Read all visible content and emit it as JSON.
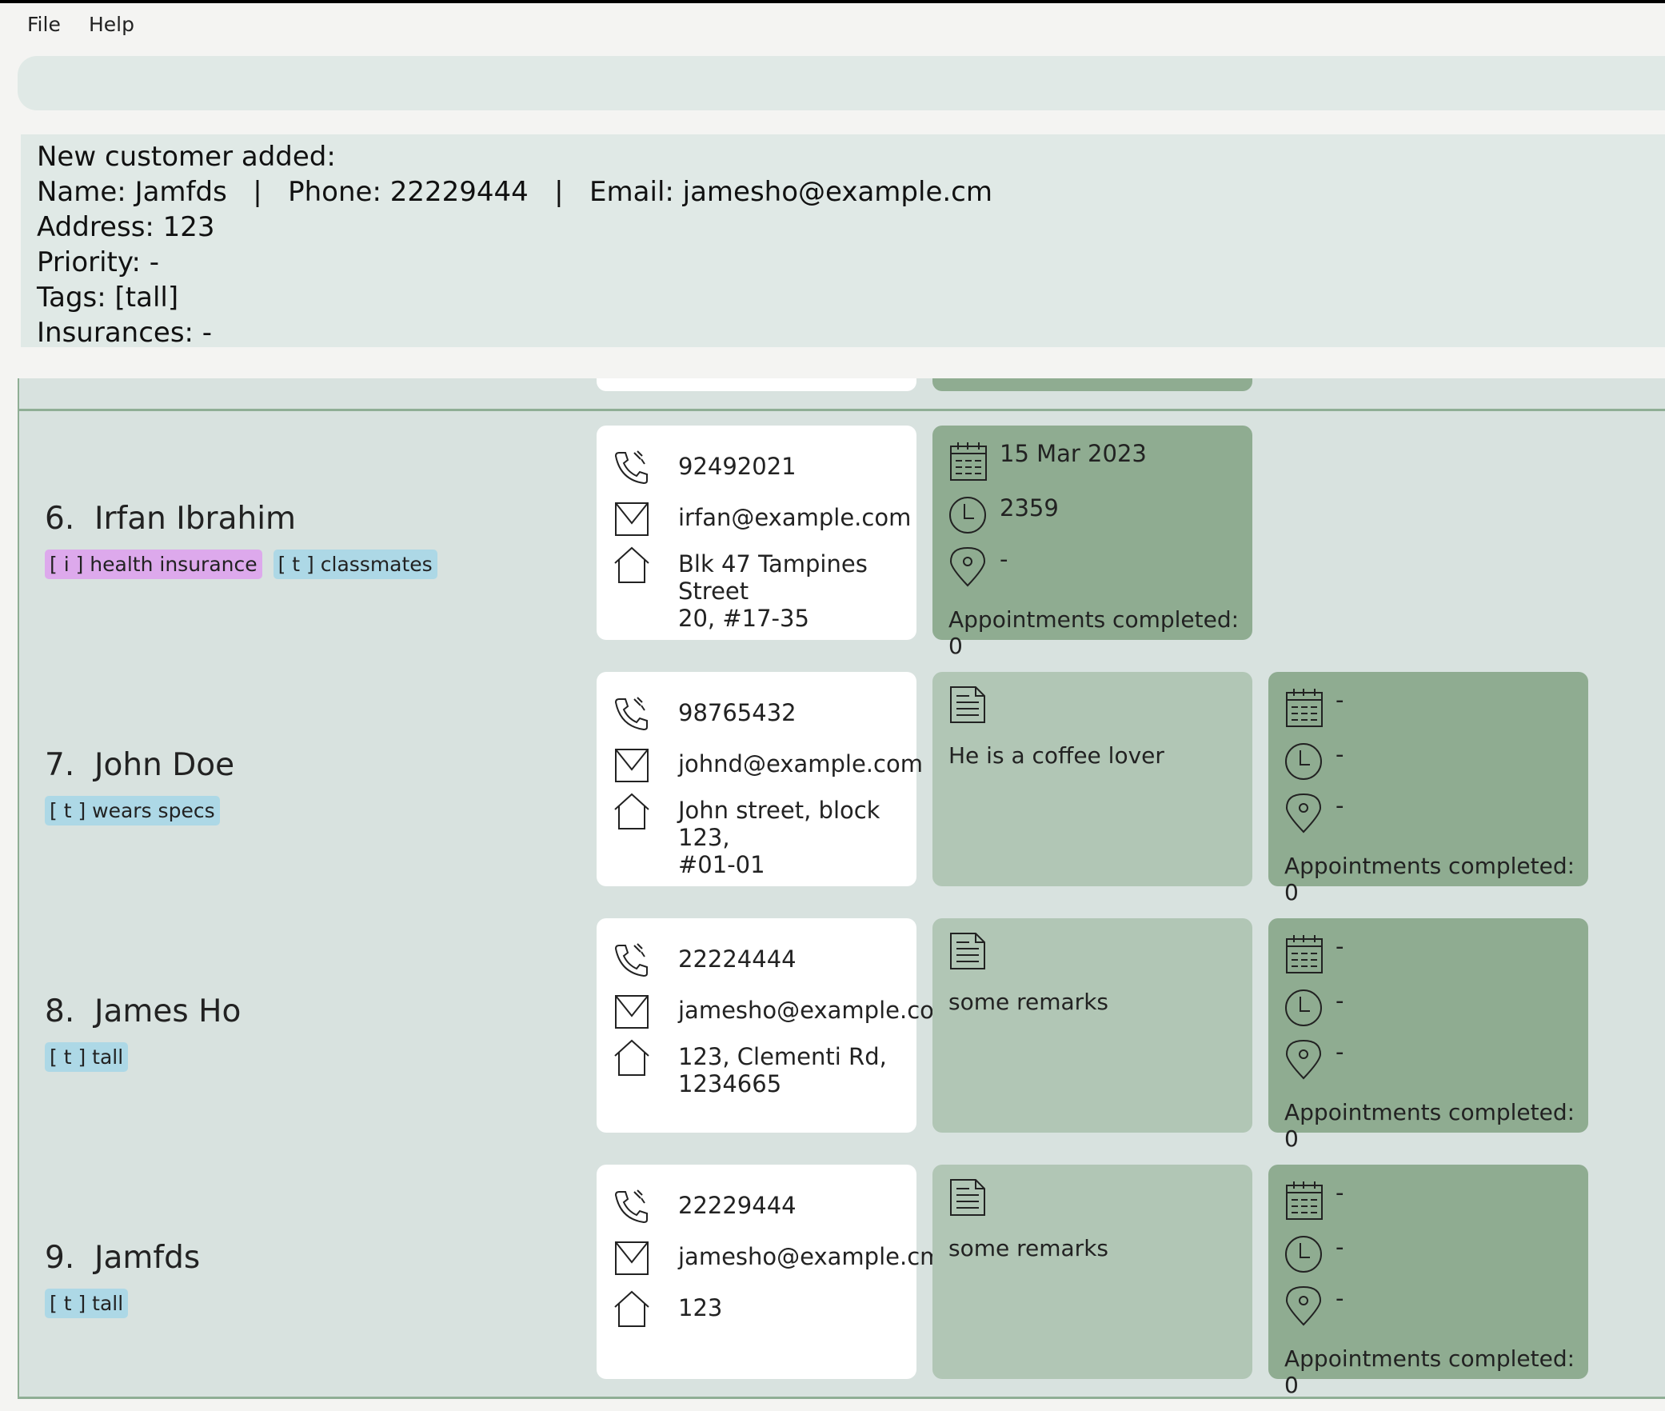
{
  "menu": {
    "file": "File",
    "help": "Help"
  },
  "command_box": {
    "value": ""
  },
  "result": {
    "line1": "New customer added:",
    "line2": "Name: Jamfds   |   Phone: 22229444   |   Email: jamesho@example.cm",
    "line3": "Address: 123",
    "line4": "Priority: -",
    "line5": "Tags: [tall]",
    "line6": "Insurances: -"
  },
  "customers": [
    {
      "index": "6.",
      "name": "Irfan Ibrahim",
      "insurance_tag": "[ i ] health insurance",
      "tag": "[ t ] classmates",
      "phone": "92492021",
      "email": "irfan@example.com",
      "address_line1": "Blk 47 Tampines Street",
      "address_line2": "20, #17-35",
      "appt_date": "15 Mar 2023",
      "appt_time": "2359",
      "appt_location": "-",
      "appt_completed": "Appointments completed: 0"
    },
    {
      "index": "7.",
      "name": "John Doe",
      "tag": "[ t ] wears specs",
      "phone": "98765432",
      "email": "johnd@example.com",
      "address_line1": "John street, block 123,",
      "address_line2": "#01-01",
      "remark": "He is a coffee lover",
      "appt_date": "-",
      "appt_time": "-",
      "appt_location": "-",
      "appt_completed": "Appointments completed: 0"
    },
    {
      "index": "8.",
      "name": "James Ho",
      "tag": "[ t ] tall",
      "phone": "22224444",
      "email": "jamesho@example.com",
      "address_line1": "123, Clementi Rd,",
      "address_line2": "1234665",
      "remark": "some remarks",
      "appt_date": "-",
      "appt_time": "-",
      "appt_location": "-",
      "appt_completed": "Appointments completed: 0"
    },
    {
      "index": "9.",
      "name": "Jamfds",
      "tag": "[ t ] tall",
      "phone": "22229444",
      "email": "jamesho@example.cm",
      "address_line1": "123",
      "address_line2": "",
      "remark": "some remarks",
      "appt_date": "-",
      "appt_time": "-",
      "appt_location": "-",
      "appt_completed": "Appointments completed: 0"
    }
  ],
  "icons": {
    "phone": "phone-icon",
    "email": "mail-icon",
    "address": "home-icon",
    "remark": "document-icon",
    "date": "calendar-icon",
    "time": "clock-icon",
    "location": "location-pin-icon"
  }
}
